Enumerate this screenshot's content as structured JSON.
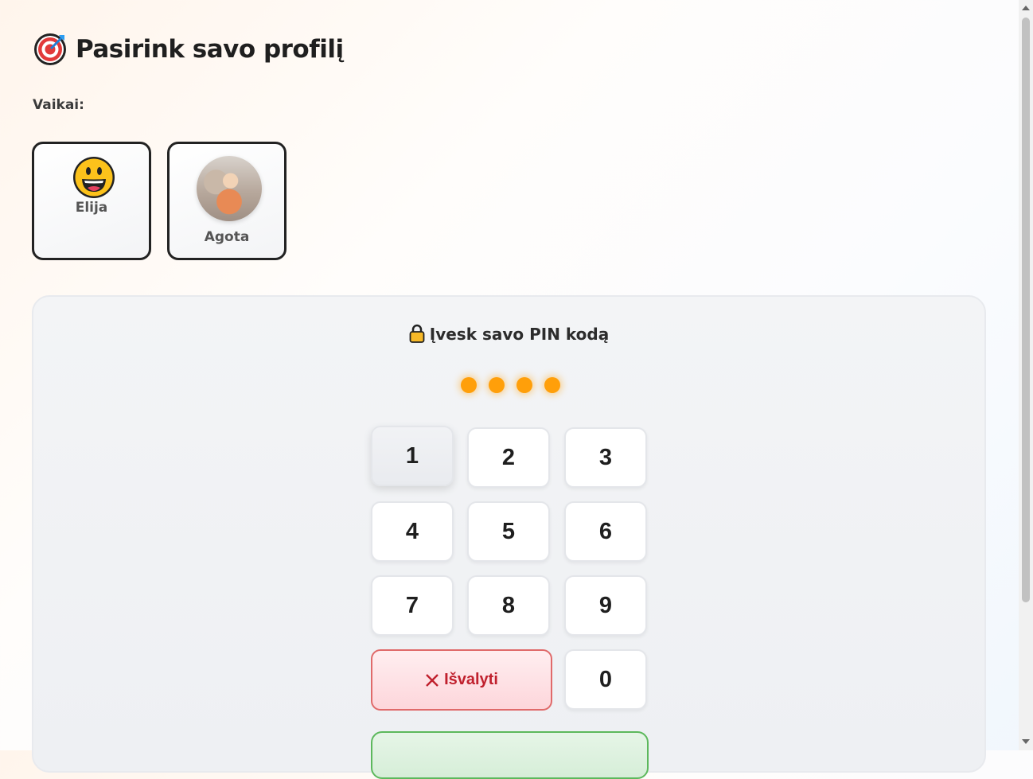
{
  "header": {
    "icon": "dart-target-icon",
    "title": "Pasirink savo profilį"
  },
  "section_label": "Vaikai:",
  "profiles": [
    {
      "name": "Elija",
      "avatar": "grinning-face-emoji"
    },
    {
      "name": "Agota",
      "avatar": "photo"
    }
  ],
  "pin": {
    "title": "Įvesk savo PIN kodą",
    "icon": "lock-icon",
    "dots_filled": 4,
    "dot_color": "#ff9f0a",
    "keys": [
      "1",
      "2",
      "3",
      "4",
      "5",
      "6",
      "7",
      "8",
      "9",
      "0"
    ],
    "clear_label": "Išvalyti"
  },
  "colors": {
    "accent_orange": "#ff9f0a",
    "clear_red": "#c0202d",
    "submit_green": "#5cb85c"
  }
}
